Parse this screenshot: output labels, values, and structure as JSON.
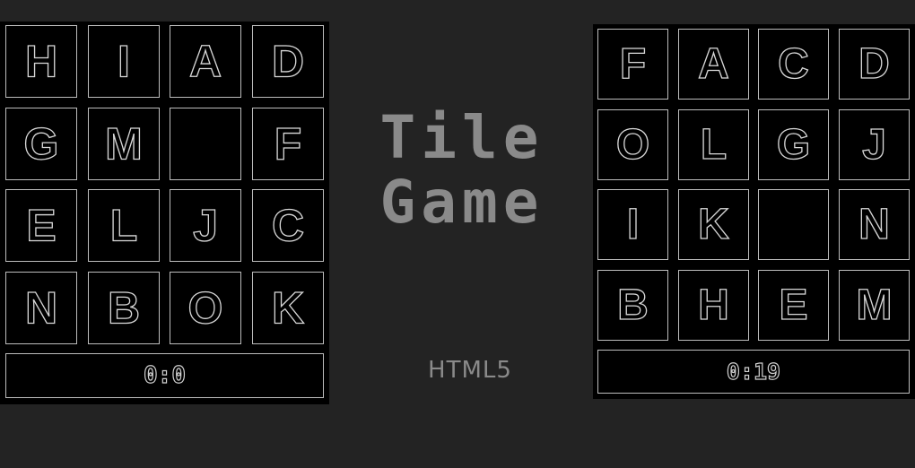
{
  "game": {
    "title_line1": "Tile",
    "title_line2": "Game",
    "subtitle": "HTML5"
  },
  "boards": {
    "left": {
      "tiles": [
        "H",
        "I",
        "A",
        "D",
        "G",
        "M",
        "",
        "F",
        "E",
        "L",
        "J",
        "C",
        "N",
        "B",
        "O",
        "K"
      ],
      "timer": "0:0"
    },
    "right": {
      "tiles": [
        "F",
        "A",
        "C",
        "D",
        "O",
        "L",
        "G",
        "J",
        "I",
        "K",
        "",
        "N",
        "B",
        "H",
        "E",
        "M"
      ],
      "timer": "0:19"
    }
  }
}
